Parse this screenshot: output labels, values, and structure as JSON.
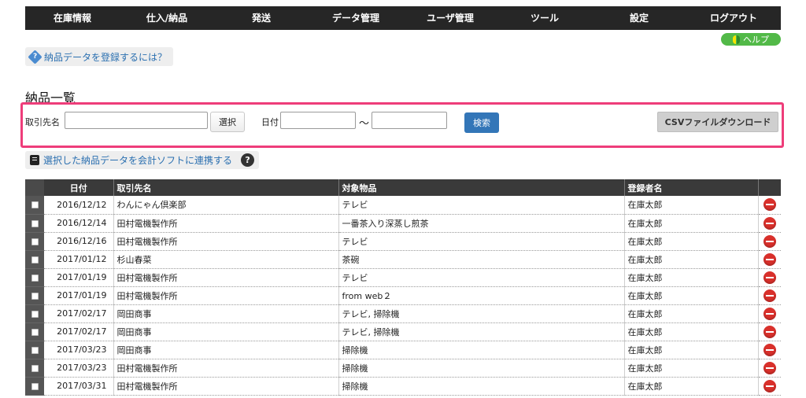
{
  "nav": {
    "items": [
      "在庫情報",
      "仕入/納品",
      "発送",
      "データ管理",
      "ユーザ管理",
      "ツール",
      "設定",
      "ログアウト"
    ]
  },
  "help": {
    "label": "ヘルプ"
  },
  "howto": {
    "label": "納品データを登録するには？"
  },
  "page": {
    "title": "納品一覧"
  },
  "search": {
    "client_label": "取引先名",
    "client_value": "",
    "select_button": "選択",
    "date_label": "日付",
    "date_from": "",
    "date_sep": "〜",
    "date_to": "",
    "search_button": "検索",
    "csv_button": "CSVファイルダウンロード"
  },
  "link_soft": {
    "label": "選択した納品データを会計ソフトに連携する"
  },
  "table": {
    "headers": {
      "date": "日付",
      "client": "取引先名",
      "item": "対象物品",
      "user": "登録者名"
    },
    "rows": [
      {
        "date": "2016/12/12",
        "client": "わんにゃん倶楽部",
        "item": "テレビ",
        "user": "在庫太郎"
      },
      {
        "date": "2016/12/14",
        "client": "田村電機製作所",
        "item": "一番茶入り深蒸し煎茶",
        "user": "在庫太郎"
      },
      {
        "date": "2016/12/16",
        "client": "田村電機製作所",
        "item": "テレビ",
        "user": "在庫太郎"
      },
      {
        "date": "2017/01/12",
        "client": "杉山春菜",
        "item": "茶碗",
        "user": "在庫太郎"
      },
      {
        "date": "2017/01/19",
        "client": "田村電機製作所",
        "item": "テレビ",
        "user": "在庫太郎"
      },
      {
        "date": "2017/01/19",
        "client": "田村電機製作所",
        "item": "from web２",
        "user": "在庫太郎"
      },
      {
        "date": "2017/02/17",
        "client": "岡田商事",
        "item": "テレビ, 掃除機",
        "user": "在庫太郎"
      },
      {
        "date": "2017/02/17",
        "client": "岡田商事",
        "item": "テレビ, 掃除機",
        "user": "在庫太郎"
      },
      {
        "date": "2017/03/23",
        "client": "岡田商事",
        "item": "掃除機",
        "user": "在庫太郎"
      },
      {
        "date": "2017/03/23",
        "client": "田村電機製作所",
        "item": "掃除機",
        "user": "在庫太郎"
      },
      {
        "date": "2017/03/31",
        "client": "田村電機製作所",
        "item": "掃除機",
        "user": "在庫太郎"
      }
    ]
  },
  "colors": {
    "nav_bg": "#262626",
    "highlight": "#ee3d7a",
    "primary": "#3376b8",
    "help_green": "#52b948",
    "delete_red": "#d9302b"
  }
}
